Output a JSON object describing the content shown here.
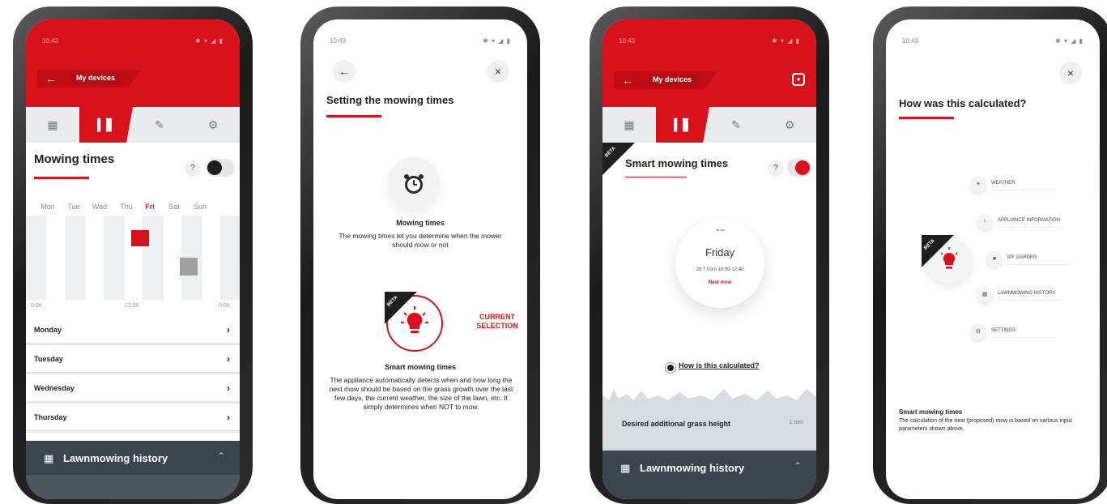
{
  "colors": {
    "brand_red": "#d7121b",
    "dark": "#3b454d",
    "light_gray": "#eef1f3"
  },
  "screen1": {
    "status_time": "10:43",
    "status_icons": "✱ ▾ ◢ ▮",
    "back_label": "My devices",
    "tabs": [
      "grid-icon",
      "chart-icon",
      "wrench-icon",
      "gear-icon"
    ],
    "title": "Mowing times",
    "help": "?",
    "days": [
      "Mon",
      "Tue",
      "Wed",
      "Thu",
      "Fri",
      "Sat",
      "Sun"
    ],
    "today": "Fri",
    "axis": [
      "0:00",
      "12:00",
      "0:00"
    ],
    "rows": [
      "Monday",
      "Tuesday",
      "Wednesday",
      "Thursday"
    ],
    "history_label": "Lawnmowing history"
  },
  "screen2": {
    "status_time": "10:43",
    "status_icons": "✱ ▾ ◢ ▮",
    "title": "Setting the mowing times",
    "opt1_title": "Mowing times",
    "opt1_desc": "The mowing times let you determine when the mower should mow or not",
    "beta": "BETA",
    "current_selection": "CURRENT SELECTION",
    "opt2_title": "Smart mowing times",
    "opt2_desc": "The appliance automatically detects when and how long the next mow should be based on the grass growth over the last few days, the current weather, the size of the lawn, etc. It simply determines when NOT to mow."
  },
  "screen3": {
    "status_time": "10:43",
    "status_icons": "✱ ▾ ◢ ▮",
    "back_label": "My devices",
    "beta": "BETA",
    "title": "Smart mowing times",
    "help": "?",
    "dial_top": "☁☁",
    "dial_day": "Friday",
    "dial_time": "28.7 from 10:50-12:40",
    "dial_next": "Next mow",
    "calc_link": "How is this calculated?",
    "grass_label": "Desired additional grass height",
    "grass_value": "1 mm",
    "history_label": "Lawnmowing history"
  },
  "screen4": {
    "status_time": "10:43",
    "status_icons": "✱ ▾ ◢ ▮",
    "title": "How was this calculated?",
    "beta": "BETA",
    "nodes": [
      "WEATHER",
      "APPLIANCE INFORMATION",
      "MY GARDEN",
      "LAWNMOWING HISTORY",
      "SETTINGS"
    ],
    "foot_title": "Smart mowing times",
    "foot_desc": "The calculation of the next (proposed) mow is based on various input parameters shown above."
  }
}
